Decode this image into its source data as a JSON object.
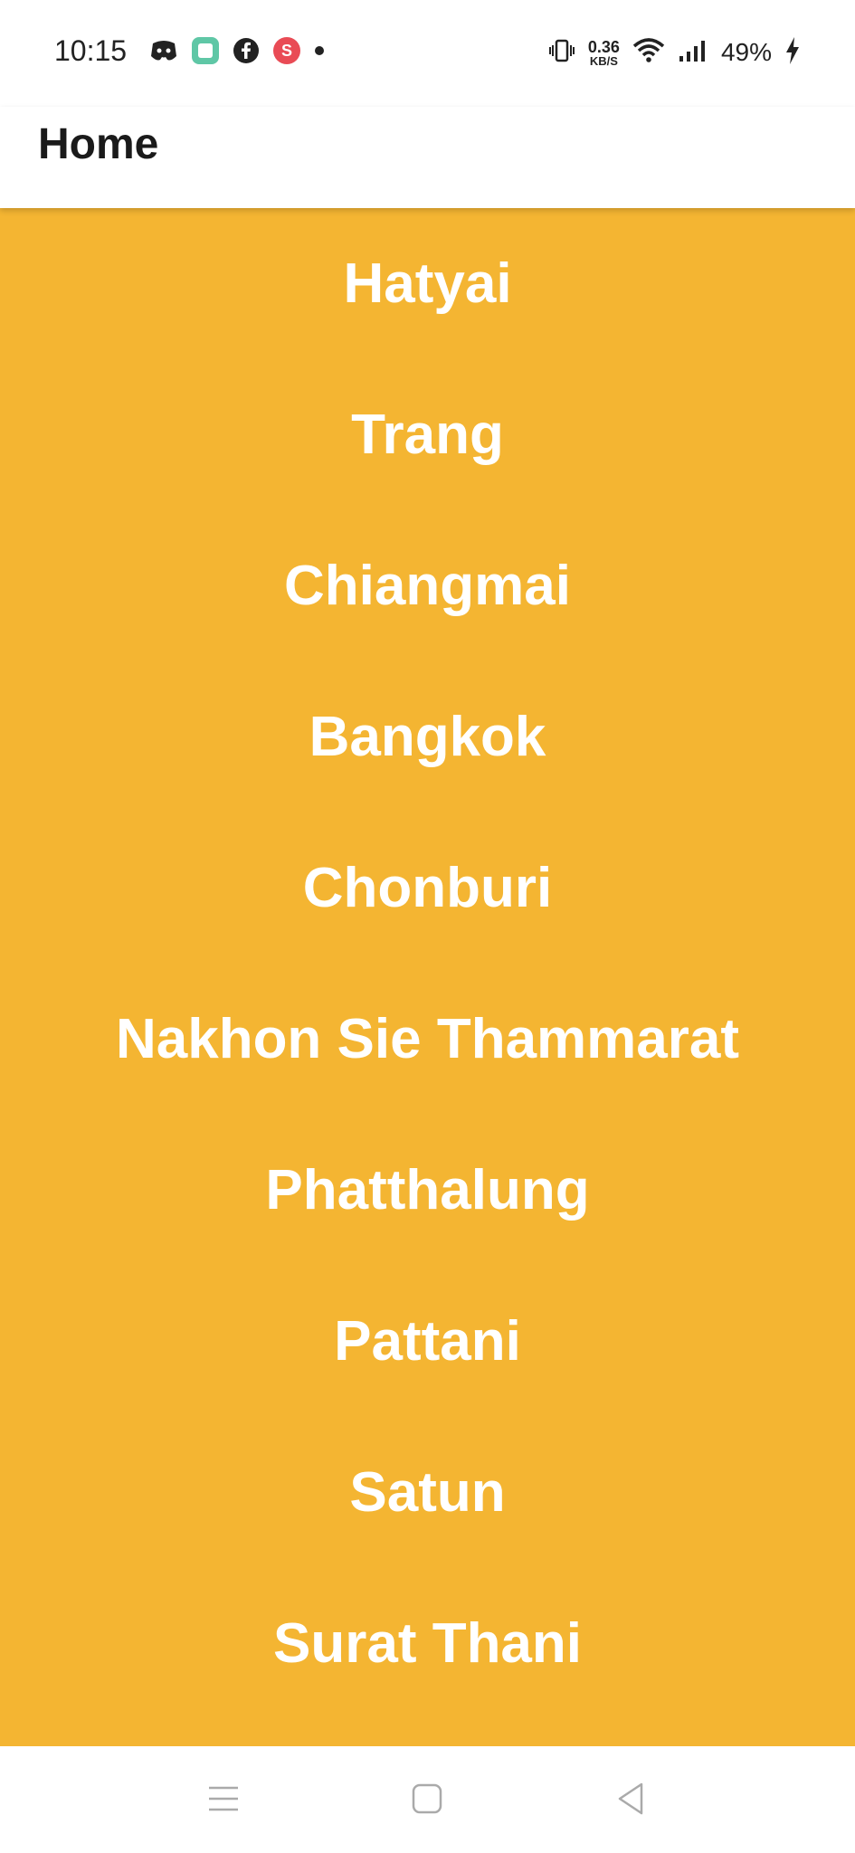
{
  "status_bar": {
    "time": "10:15",
    "net_speed_value": "0.36",
    "net_speed_unit": "KB/S",
    "battery_percent": "49%",
    "left_icons": [
      "discord-icon",
      "app-icon",
      "facebook-icon",
      "s-app-icon",
      "dot-icon"
    ],
    "right_icons": [
      "vibrate-icon",
      "wifi-icon",
      "signal-icon",
      "charging-icon"
    ]
  },
  "app_bar": {
    "title": "Home"
  },
  "colors": {
    "list_background": "#f4b532",
    "item_text": "#ffffff",
    "app_bar_background": "#ffffff"
  },
  "cities": [
    "Hatyai",
    "Trang",
    "Chiangmai",
    "Bangkok",
    "Chonburi",
    "Nakhon Sie Thammarat",
    "Phatthalung",
    "Pattani",
    "Satun",
    "Surat Thani"
  ],
  "nav_bar": {
    "buttons": [
      "menu-icon",
      "home-icon",
      "back-icon"
    ]
  }
}
